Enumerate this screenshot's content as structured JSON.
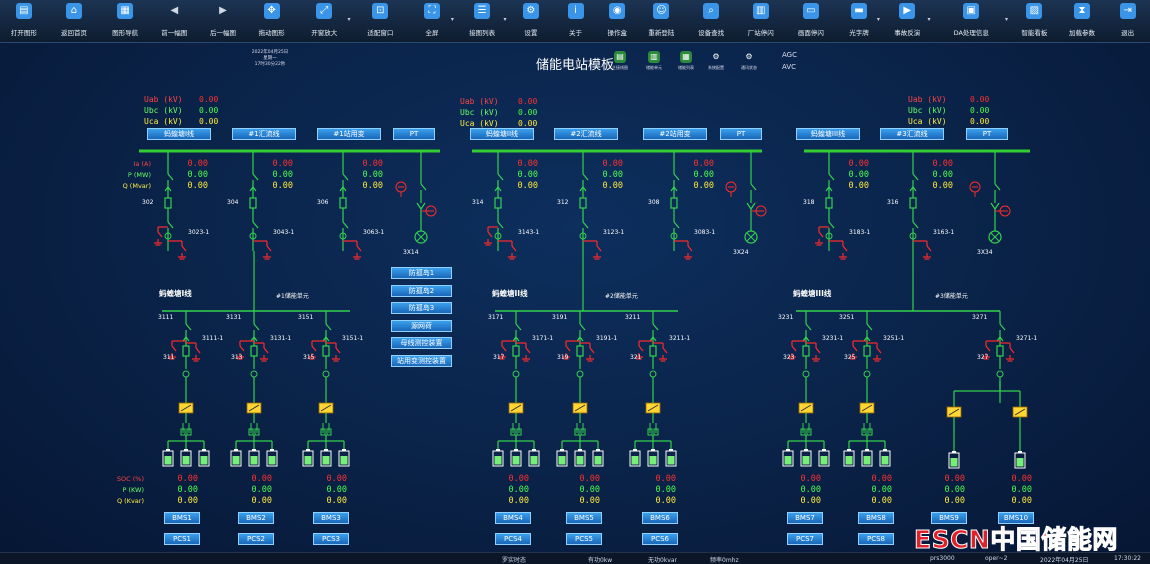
{
  "toolbar": [
    {
      "label": "打开图形",
      "icon": "folder-open-icon"
    },
    {
      "label": "返回首页",
      "icon": "home-icon"
    },
    {
      "label": "图形导航",
      "icon": "grid-icon"
    },
    {
      "label": "前一幅图",
      "icon": "prev-icon"
    },
    {
      "label": "后一幅图",
      "icon": "next-icon"
    },
    {
      "label": "拖动图形",
      "icon": "move-icon"
    },
    {
      "label": "开窗放大",
      "icon": "zoom-window-icon",
      "dropdown": true
    },
    {
      "label": "适配窗口",
      "icon": "fit-window-icon"
    },
    {
      "label": "全屏",
      "icon": "fullscreen-icon",
      "dropdown": true
    },
    {
      "label": "接图列表",
      "icon": "list-icon",
      "dropdown": true
    },
    {
      "label": "设置",
      "icon": "gear-icon"
    },
    {
      "label": "关于",
      "icon": "info-icon"
    },
    {
      "label": "操作盒",
      "icon": "operation-box-icon"
    },
    {
      "label": "重新登陆",
      "icon": "users-icon"
    },
    {
      "label": "设备查找",
      "icon": "search-icon"
    },
    {
      "label": "厂站停闪",
      "icon": "station-icon"
    },
    {
      "label": "画面停闪",
      "icon": "screen-icon"
    },
    {
      "label": "光字牌",
      "icon": "signboard-icon",
      "dropdown": true
    },
    {
      "label": "事故反演",
      "icon": "playback-icon",
      "dropdown": true
    },
    {
      "label": "DA处理信息",
      "icon": "da-info-icon",
      "dropdown": true
    },
    {
      "label": "智能看板",
      "icon": "dashboard-icon"
    },
    {
      "label": "加载参数",
      "icon": "hourglass-icon"
    },
    {
      "label": "退出",
      "icon": "exit-icon"
    }
  ],
  "header": {
    "datetime": [
      "2022年04月25日",
      "星期一",
      "17时30分22秒"
    ],
    "title": "储能电站模板",
    "mini_icons": [
      {
        "label": "主接线图",
        "icon": "main-wiring-icon"
      },
      {
        "label": "储能单元",
        "icon": "storage-unit-icon"
      },
      {
        "label": "储能列表",
        "icon": "storage-list-icon"
      },
      {
        "label": "系统配置",
        "icon": "system-config-icon"
      },
      {
        "label": "通讯状态",
        "icon": "comm-status-icon"
      }
    ],
    "agc": "AGC",
    "avc": "AVC"
  },
  "voltage_labels": [
    "Uab (kV)",
    "Ubc (kV)",
    "Uca (kV)"
  ],
  "sections": [
    {
      "voltages": [
        "0.00",
        "0.00",
        "0.00"
      ],
      "buttons": [
        "蚂蝗塘I线",
        "#1汇流线",
        "#1站用变",
        "PT"
      ],
      "feeder_labels": [
        "Ia (A)",
        "P (MW)",
        "Q (Mvar)"
      ],
      "feeder_values": [
        [
          "0.00",
          "0.00",
          "0.00"
        ],
        [
          "0.00",
          "0.00",
          "0.00"
        ],
        [
          "0.00",
          "0.00",
          "0.00"
        ]
      ],
      "breakers": [
        "302",
        "304",
        "306"
      ],
      "grounds": [
        "3023-1",
        "3043-1",
        "3063-1"
      ],
      "transformer": "3X14",
      "line_title": "蚂蝗塘I线",
      "unit_title": "#1储能单元",
      "branch_isolators": [
        "3111",
        "3131",
        "3151"
      ],
      "branch_grounds": [
        "3111-1",
        "3131-1",
        "3151-1"
      ],
      "branch_breakers": [
        "311",
        "313",
        "315"
      ],
      "bms": [
        "BMS1",
        "BMS2",
        "BMS3"
      ],
      "pcs": [
        "PCS1",
        "PCS2",
        "PCS3"
      ],
      "soc": [
        [
          "0.00",
          "0.00",
          "0.00"
        ],
        [
          "0.00",
          "0.00",
          "0.00"
        ],
        [
          "0.00",
          "0.00",
          "0.00"
        ]
      ]
    },
    {
      "voltages": [
        "0.00",
        "0.00",
        "0.00"
      ],
      "buttons": [
        "蚂蝗塘II线",
        "#2汇流线",
        "#2站用变",
        "PT"
      ],
      "feeder_values": [
        [
          "0.00",
          "0.00",
          "0.00"
        ],
        [
          "0.00",
          "0.00",
          "0.00"
        ],
        [
          "0.00",
          "0.00",
          "0.00"
        ]
      ],
      "breakers": [
        "314",
        "312",
        "308"
      ],
      "grounds": [
        "3143-1",
        "3123-1",
        "3083-1"
      ],
      "transformer": "3X24",
      "line_title": "蚂蝗塘II线",
      "unit_title": "#2储能单元",
      "branch_isolators": [
        "3171",
        "3191",
        "3211"
      ],
      "branch_grounds": [
        "3171-1",
        "3191-1",
        "3211-1"
      ],
      "branch_breakers": [
        "317",
        "319",
        "321"
      ],
      "bms": [
        "BMS4",
        "BMS5",
        "BMS6"
      ],
      "pcs": [
        "PCS4",
        "PCS5",
        "PCS6"
      ],
      "soc": [
        [
          "0.00",
          "0.00",
          "0.00"
        ],
        [
          "0.00",
          "0.00",
          "0.00"
        ],
        [
          "0.00",
          "0.00",
          "0.00"
        ]
      ]
    },
    {
      "voltages": [
        "0.00",
        "0.00",
        "0.00"
      ],
      "buttons": [
        "蚂蝗塘III线",
        "#3汇流线",
        "PT"
      ],
      "feeder_values": [
        [
          "0.00",
          "0.00",
          "0.00"
        ],
        [
          "0.00",
          "0.00",
          "0.00"
        ]
      ],
      "breakers": [
        "318",
        "316"
      ],
      "grounds": [
        "3183-1",
        "3163-1"
      ],
      "transformer": "3X34",
      "line_title": "蚂蝗塘III线",
      "unit_title": "#3储能单元",
      "branch_isolators": [
        "3231",
        "3251",
        "3271"
      ],
      "branch_grounds": [
        "3231-1",
        "3251-1",
        "3271-1"
      ],
      "branch_breakers": [
        "323",
        "325",
        "327"
      ],
      "bms": [
        "BMS7",
        "BMS8",
        "BMS9",
        "BMS10"
      ],
      "pcs": [
        "PCS7",
        "PCS8"
      ],
      "soc": [
        [
          "0.00",
          "0.00",
          "0.00"
        ],
        [
          "0.00",
          "0.00",
          "0.00"
        ],
        [
          "0.00",
          "0.00",
          "0.00"
        ],
        [
          "0.00",
          "0.00",
          "0.00"
        ]
      ]
    }
  ],
  "soc_labels": [
    "SOC (%)",
    "P (KW)",
    "Q (Kvar)"
  ],
  "commands": [
    "防孤岛1",
    "防孤岛2",
    "防孤岛3",
    "源网荷",
    "母线测控装置",
    "站用变测控装置"
  ],
  "statusbar": {
    "left": "罗实时态",
    "p": "有功0kw",
    "q": "无功0kvar",
    "f": "频率0mhz",
    "station": "prs3000",
    "user": "oper~2",
    "date": "2022年04月25日",
    "time": "17:30:22"
  },
  "watermark": "ESCN中国储能网",
  "colors": {
    "bus": "#33cc33",
    "wire": "#34d14e",
    "device_red": "#ff2a2a",
    "value_red": "#ff3030",
    "value_green": "#4cff4c",
    "value_yellow": "#ffea3c",
    "button": "#2a86dc"
  }
}
